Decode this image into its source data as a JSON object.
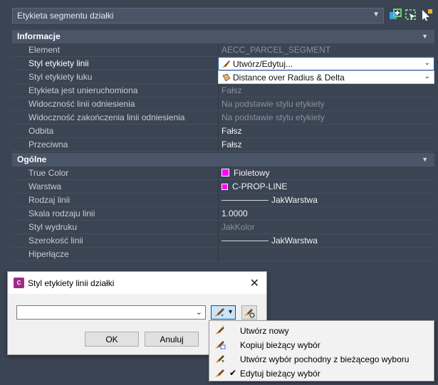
{
  "top": {
    "object_selector": "Etykieta segmentu działki"
  },
  "sections": {
    "info": {
      "title": "Informacje",
      "rows": [
        {
          "label": "Element",
          "value": "AECC_PARCEL_SEGMENT"
        },
        {
          "label": "Styl etykiety linii",
          "value": "Utwórz/Edytuj..."
        },
        {
          "label": "Styl etykiety łuku",
          "value": "Distance over Radius & Delta"
        },
        {
          "label": "Etykieta jest unieruchomiona",
          "value": "Fałsz"
        },
        {
          "label": "Widoczność linii odniesienia",
          "value": "Na podstawie stylu etykiety"
        },
        {
          "label": "Widoczność zakończenia linii odniesienia",
          "value": "Na podstawie stylu etykiety"
        },
        {
          "label": "Odbita",
          "value": "Fałsz"
        },
        {
          "label": "Przeciwna",
          "value": "Fałsz"
        }
      ]
    },
    "general": {
      "title": "Ogólne",
      "rows": [
        {
          "label": "True Color",
          "value": "Fioletowy"
        },
        {
          "label": "Warstwa",
          "value": "C-PROP-LINE"
        },
        {
          "label": "Rodzaj linii",
          "value": "JakWarstwa"
        },
        {
          "label": "Skala rodzaju linii",
          "value": "1.0000"
        },
        {
          "label": "Styl wydruku",
          "value": "JakKolor"
        },
        {
          "label": "Szerokość linii",
          "value": "JakWarstwa"
        },
        {
          "label": "Hiperłącze",
          "value": ""
        }
      ]
    }
  },
  "colors": {
    "true_color_swatch": "#ff00ff",
    "layer_swatch": "#ff00ff"
  },
  "dialog": {
    "title": "Styl etykiety linii działki",
    "combo_value": "",
    "ok_label": "OK",
    "cancel_label": "Anuluj"
  },
  "menu": {
    "items": [
      {
        "label": "Utwórz nowy",
        "icon": "brush-new-icon",
        "checked": false
      },
      {
        "label": "Kopiuj bieżący wybór",
        "icon": "copy-style-icon",
        "checked": false
      },
      {
        "label": "Utwórz wybór pochodny z bieżącego wyboru",
        "icon": "child-style-icon",
        "checked": false
      },
      {
        "label": "Edytuj bieżący wybór",
        "icon": "edit-style-icon",
        "checked": true
      }
    ]
  }
}
